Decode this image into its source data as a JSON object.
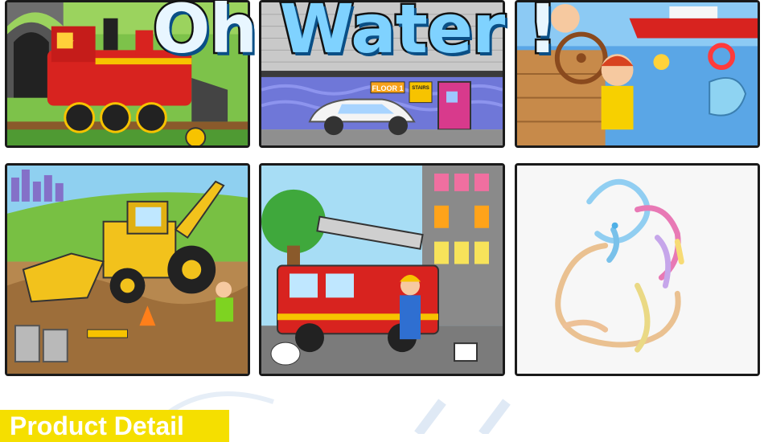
{
  "headline": {
    "word1": "Oh ",
    "word2": "Water",
    "mark": "!"
  },
  "scene_labels": {
    "floor_sign": "FLOOR 1",
    "stairs_sign": "STAIRS"
  },
  "section_banner": {
    "label": "Product Detail"
  },
  "colors": {
    "banner_yellow": "#f5df00",
    "headline_fill": "#e8f6ff",
    "headline_outline": "#111111",
    "tile_border": "#1a1a1a"
  },
  "tiles": [
    {
      "subject": "steam-locomotive"
    },
    {
      "subject": "car-parking-garage"
    },
    {
      "subject": "boy-at-ship-wheel-with-dolphin"
    },
    {
      "subject": "backhoe-construction-site"
    },
    {
      "subject": "fire-truck-and-firefighter"
    },
    {
      "subject": "water-drawn-duck"
    }
  ]
}
